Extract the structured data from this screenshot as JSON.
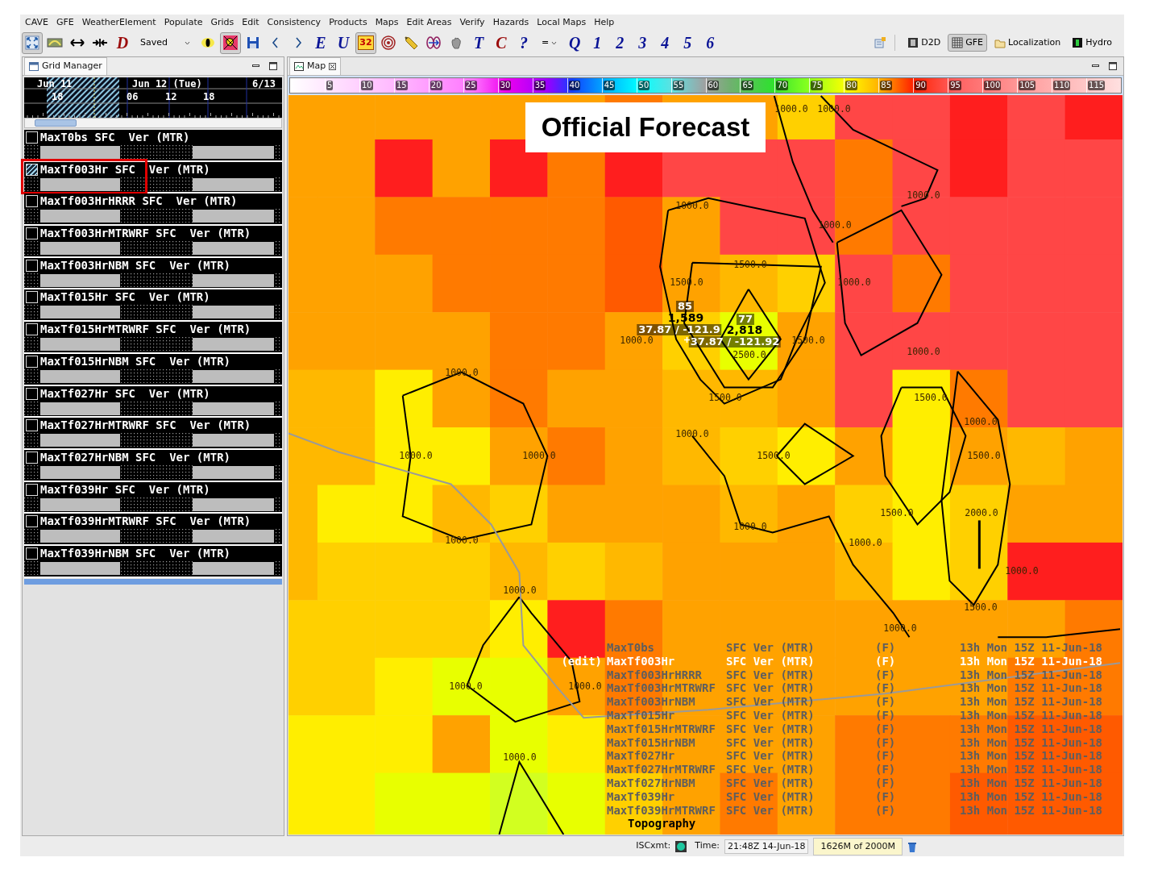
{
  "menu_bar": [
    "CAVE",
    "GFE",
    "WeatherElement",
    "Populate",
    "Grids",
    "Edit",
    "Consistency",
    "Products",
    "Maps",
    "Edit Areas",
    "Verify",
    "Hazards",
    "Local Maps",
    "Help"
  ],
  "toolbar": [
    {
      "kind": "icon",
      "selected": true
    },
    {
      "kind": "icon",
      "selected": false
    },
    {
      "kind": "icon",
      "selected": false
    },
    {
      "kind": "icon",
      "selected": false
    },
    {
      "kind": "glyph",
      "label": "D",
      "selected": false
    },
    {
      "kind": "dropdown",
      "label": "Saved"
    },
    {
      "kind": "icon",
      "selected": false
    },
    {
      "kind": "icon",
      "selected": true
    },
    {
      "kind": "icon",
      "selected": false
    },
    {
      "kind": "icon",
      "selected": false
    },
    {
      "kind": "icon",
      "selected": false
    },
    {
      "kind": "glyph",
      "label": "E",
      "selected": false
    },
    {
      "kind": "glyph",
      "label": "U",
      "selected": false
    },
    {
      "kind": "badge",
      "label": "32",
      "selected": true
    },
    {
      "kind": "icon",
      "selected": false
    },
    {
      "kind": "icon",
      "selected": false
    },
    {
      "kind": "icon",
      "selected": false
    },
    {
      "kind": "icon",
      "selected": false
    },
    {
      "kind": "glyph",
      "label": "T",
      "selected": false
    },
    {
      "kind": "glyph",
      "label": "C",
      "selected": false
    },
    {
      "kind": "glyph",
      "label": "?",
      "selected": false
    },
    {
      "kind": "dropdown",
      "label": "="
    },
    {
      "kind": "glyph",
      "label": "Q",
      "selected": false
    },
    {
      "kind": "glyph",
      "label": "1",
      "selected": false
    },
    {
      "kind": "glyph",
      "label": "2",
      "selected": false
    },
    {
      "kind": "glyph",
      "label": "3",
      "selected": false
    },
    {
      "kind": "glyph",
      "label": "4",
      "selected": false
    },
    {
      "kind": "glyph",
      "label": "5",
      "selected": false
    },
    {
      "kind": "glyph",
      "label": "6",
      "selected": false
    }
  ],
  "perspectives": [
    {
      "label": "D2D",
      "selected": false
    },
    {
      "label": "GFE",
      "selected": true
    },
    {
      "label": "Localization",
      "selected": false
    },
    {
      "label": "Hydro",
      "selected": false
    }
  ],
  "grid_manager": {
    "title": "Grid Manager",
    "timeline": {
      "days": [
        "Jun 11",
        "Jun 12 (Tue)",
        "6/13"
      ],
      "hours": [
        "18",
        "06",
        "12",
        "18"
      ]
    },
    "rows": [
      {
        "label": "MaxT0bs SFC  Ver (MTR)",
        "selected": false
      },
      {
        "label": "MaxTf003Hr SFC  Ver (MTR)",
        "selected": true
      },
      {
        "label": "MaxTf003HrHRRR SFC  Ver (MTR)",
        "selected": false
      },
      {
        "label": "MaxTf003HrMTRWRF SFC  Ver (MTR)",
        "selected": false
      },
      {
        "label": "MaxTf003HrNBM SFC  Ver (MTR)",
        "selected": false
      },
      {
        "label": "MaxTf015Hr SFC  Ver (MTR)",
        "selected": false
      },
      {
        "label": "MaxTf015HrMTRWRF SFC  Ver (MTR)",
        "selected": false
      },
      {
        "label": "MaxTf015HrNBM SFC  Ver (MTR)",
        "selected": false
      },
      {
        "label": "MaxTf027Hr SFC  Ver (MTR)",
        "selected": false
      },
      {
        "label": "MaxTf027HrMTRWRF SFC  Ver (MTR)",
        "selected": false
      },
      {
        "label": "MaxTf027HrNBM SFC  Ver (MTR)",
        "selected": false
      },
      {
        "label": "MaxTf039Hr SFC  Ver (MTR)",
        "selected": false
      },
      {
        "label": "MaxTf039HrMTRWRF SFC  Ver (MTR)",
        "selected": false
      },
      {
        "label": "MaxTf039HrNBM SFC  Ver (MTR)",
        "selected": false
      }
    ]
  },
  "map": {
    "tab": "Map",
    "color_scale": {
      "ticks": [
        "5",
        "10",
        "15",
        "20",
        "25",
        "30",
        "35",
        "40",
        "45",
        "50",
        "55",
        "60",
        "65",
        "70",
        "75",
        "80",
        "85",
        "90",
        "95",
        "100",
        "105",
        "110",
        "115"
      ]
    },
    "banner": "Official Forecast",
    "contour_labels": [
      "1000.0",
      "1000.0",
      "1000.0",
      "1000.0",
      "1000.0",
      "1500.0",
      "1500.0",
      "1000.0",
      "1000.0",
      "1500.0",
      "2500.0",
      "1000.0",
      "1000.0",
      "1500.0",
      "1500.0",
      "1000.0",
      "1000.0",
      "1000.0",
      "1000.0",
      "1500.0",
      "1500.0",
      "1500.0",
      "2000.0",
      "1000.0",
      "1000.0",
      "1000.0",
      "1000.0",
      "1000.0",
      "1500.0",
      "1000.0",
      "1000.0",
      "1000.0",
      "1000.0"
    ],
    "samples": [
      "85",
      "1,589",
      "37.87 / -121.9",
      "77",
      "2,818",
      "37.87 / -121.92"
    ],
    "legend": {
      "rows": [
        {
          "name": "MaxT0bs",
          "field": "SFC Ver (MTR)",
          "mode": "(F)",
          "time": "13h Mon 15Z 11-Jun-18",
          "selected": false
        },
        {
          "prefix": "(edit)",
          "name": "MaxTf003Hr",
          "field": "SFC Ver (MTR)",
          "mode": "(F)",
          "time": "13h Mon 15Z 11-Jun-18",
          "selected": true
        },
        {
          "name": "MaxTf003HrHRRR",
          "field": "SFC Ver (MTR)",
          "mode": "(F)",
          "time": "13h Mon 15Z 11-Jun-18",
          "selected": false
        },
        {
          "name": "MaxTf003HrMTRWRF",
          "field": "SFC Ver (MTR)",
          "mode": "(F)",
          "time": "13h Mon 15Z 11-Jun-18",
          "selected": false
        },
        {
          "name": "MaxTf003HrNBM",
          "field": "SFC Ver (MTR)",
          "mode": "(F)",
          "time": "13h Mon 15Z 11-Jun-18",
          "selected": false
        },
        {
          "name": "MaxTf015Hr",
          "field": "SFC Ver (MTR)",
          "mode": "(F)",
          "time": "13h Mon 15Z 11-Jun-18",
          "selected": false
        },
        {
          "name": "MaxTf015HrMTRWRF",
          "field": "SFC Ver (MTR)",
          "mode": "(F)",
          "time": "13h Mon 15Z 11-Jun-18",
          "selected": false
        },
        {
          "name": "MaxTf015HrNBM",
          "field": "SFC Ver (MTR)",
          "mode": "(F)",
          "time": "13h Mon 15Z 11-Jun-18",
          "selected": false
        },
        {
          "name": "MaxTf027Hr",
          "field": "SFC Ver (MTR)",
          "mode": "(F)",
          "time": "13h Mon 15Z 11-Jun-18",
          "selected": false
        },
        {
          "name": "MaxTf027HrMTRWRF",
          "field": "SFC Ver (MTR)",
          "mode": "(F)",
          "time": "13h Mon 15Z 11-Jun-18",
          "selected": false
        },
        {
          "name": "MaxTf027HrNBM",
          "field": "SFC Ver (MTR)",
          "mode": "(F)",
          "time": "13h Mon 15Z 11-Jun-18",
          "selected": false
        },
        {
          "name": "MaxTf039Hr",
          "field": "SFC Ver (MTR)",
          "mode": "(F)",
          "time": "13h Mon 15Z 11-Jun-18",
          "selected": false
        },
        {
          "name": "MaxTf039HrMTRWRF",
          "field": "SFC Ver (MTR)",
          "mode": "(F)",
          "time": "13h Mon 15Z 11-Jun-18",
          "selected": false
        }
      ],
      "footer": "Topography"
    }
  },
  "status_bar": {
    "isc_label": "ISCxmt:",
    "time_label": "Time:",
    "time": "21:48Z 14-Jun-18",
    "memory": "1626M of 2000M"
  }
}
